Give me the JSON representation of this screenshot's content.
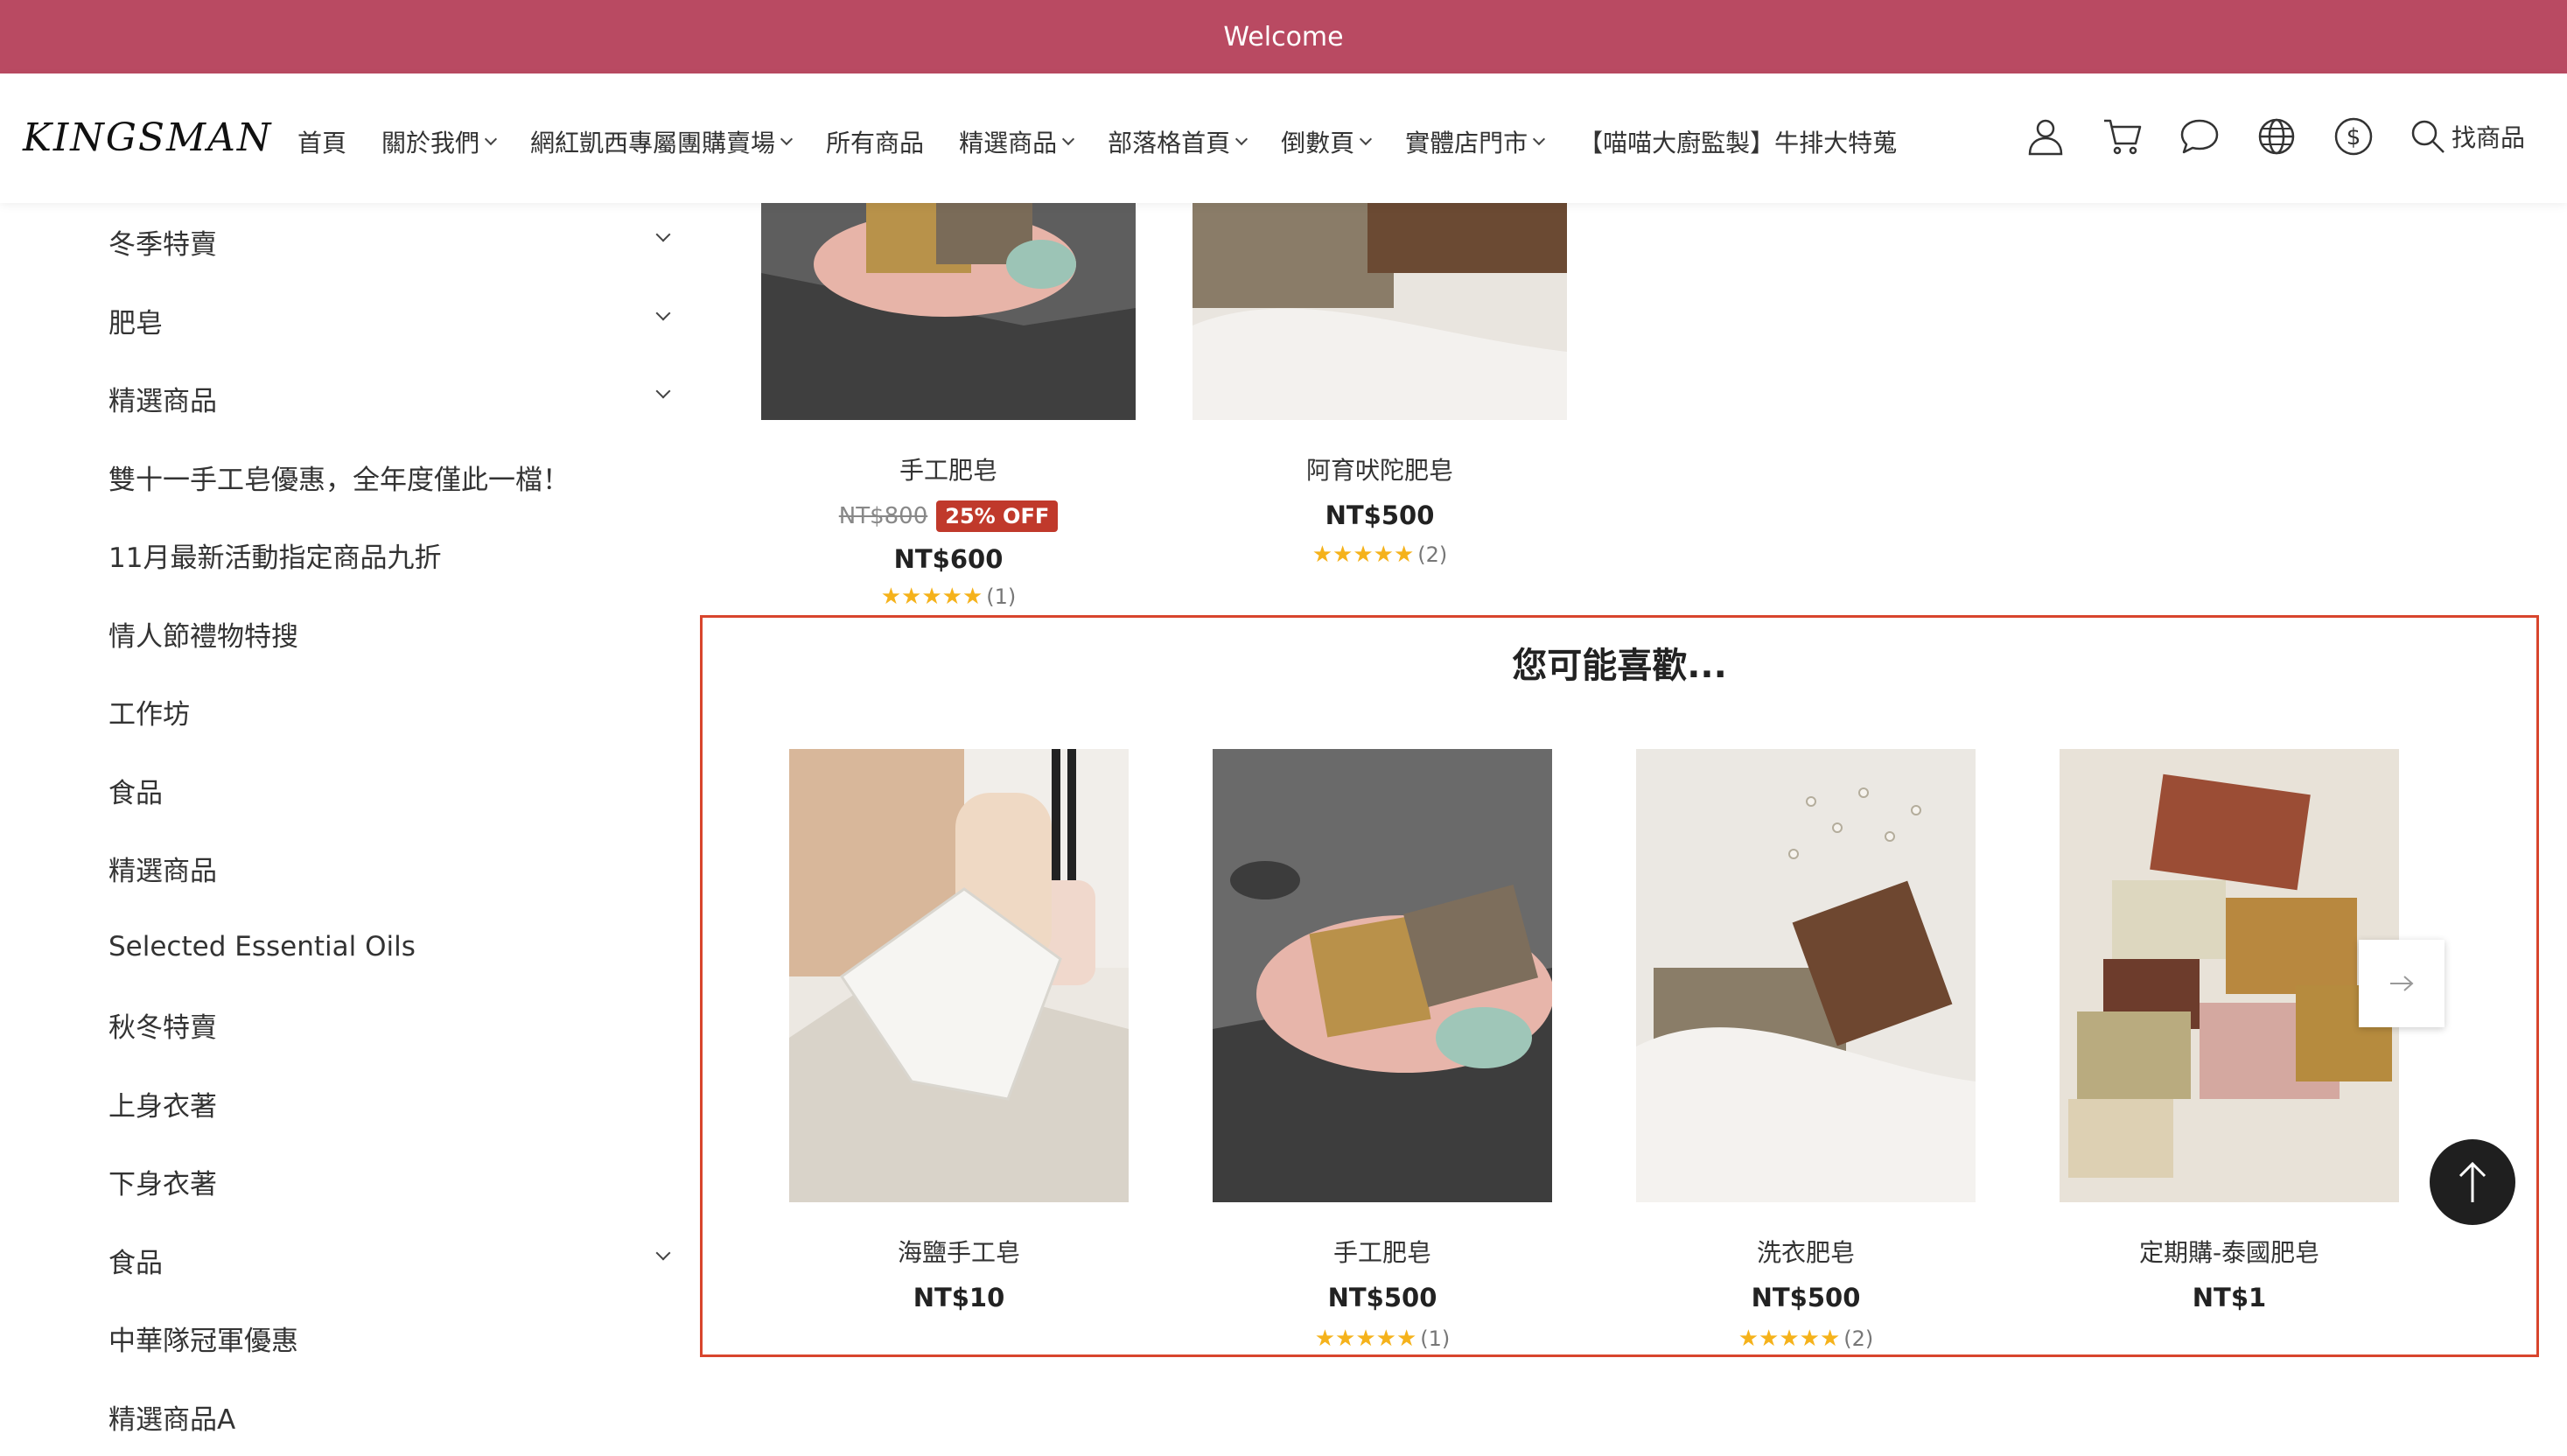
{
  "welcome": "Welcome",
  "header": {
    "logo": "KINGSMAN",
    "nav": [
      {
        "label": "首頁",
        "has_dropdown": false
      },
      {
        "label": "關於我們",
        "has_dropdown": true
      },
      {
        "label": "網紅凱西專屬團購賣場",
        "has_dropdown": true
      },
      {
        "label": "所有商品",
        "has_dropdown": false
      },
      {
        "label": "精選商品",
        "has_dropdown": true
      },
      {
        "label": "部落格首頁",
        "has_dropdown": true
      },
      {
        "label": "倒數頁",
        "has_dropdown": true
      },
      {
        "label": "實體店門市",
        "has_dropdown": true
      },
      {
        "label": "【喵喵大廚監製】牛排大特蒐",
        "has_dropdown": false
      }
    ],
    "icons": [
      "user-icon",
      "cart-icon",
      "chat-icon",
      "globe-icon",
      "currency-icon"
    ],
    "search_label": "找商品"
  },
  "sidebar": {
    "items": [
      {
        "label": "冬季特賣",
        "has_dropdown": true
      },
      {
        "label": "肥皂",
        "has_dropdown": true
      },
      {
        "label": "精選商品",
        "has_dropdown": true
      },
      {
        "label": "雙十一手工皂優惠，全年度僅此一檔！",
        "has_dropdown": false
      },
      {
        "label": "11月最新活動指定商品九折",
        "has_dropdown": false
      },
      {
        "label": "情人節禮物特搜",
        "has_dropdown": false
      },
      {
        "label": "工作坊",
        "has_dropdown": false
      },
      {
        "label": "食品",
        "has_dropdown": false
      },
      {
        "label": "精選商品",
        "has_dropdown": false
      },
      {
        "label": "Selected Essential Oils",
        "has_dropdown": false
      },
      {
        "label": "秋冬特賣",
        "has_dropdown": false
      },
      {
        "label": "上身衣著",
        "has_dropdown": false
      },
      {
        "label": "下身衣著",
        "has_dropdown": false
      },
      {
        "label": "食品",
        "has_dropdown": true
      },
      {
        "label": "中華隊冠軍優惠",
        "has_dropdown": false
      },
      {
        "label": "精選商品A",
        "has_dropdown": false
      }
    ]
  },
  "top_products": [
    {
      "name": "手工肥皂",
      "old_price": "NT$800",
      "badge": "25% OFF",
      "price": "NT$600",
      "stars": 5,
      "reviews": "(1)"
    },
    {
      "name": "阿育吠陀肥皂",
      "old_price": "",
      "badge": "",
      "price": "NT$500",
      "stars": 5,
      "reviews": "(2)"
    }
  ],
  "recommend": {
    "title": "您可能喜歡...",
    "items": [
      {
        "name": "海鹽手工皂",
        "price": "NT$10",
        "stars": 0,
        "reviews": ""
      },
      {
        "name": "手工肥皂",
        "price": "NT$500",
        "stars": 5,
        "reviews": "(1)"
      },
      {
        "name": "洗衣肥皂",
        "price": "NT$500",
        "stars": 5,
        "reviews": "(2)"
      },
      {
        "name": "定期購-泰國肥皂",
        "price": "NT$1",
        "stars": 0,
        "reviews": ""
      }
    ]
  },
  "colors": {
    "welcome_bg": "#b94a62",
    "badge": "#c0392b",
    "star": "#f5b21b",
    "highlight_border": "#d8452d"
  }
}
